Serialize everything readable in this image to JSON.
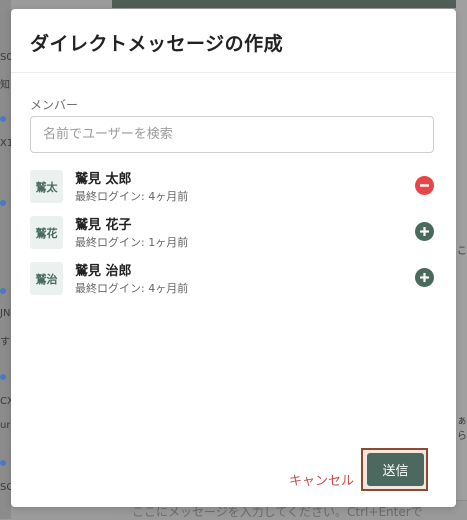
{
  "background": {
    "side_fragments": [
      "S0",
      "知",
      "X1",
      "JN",
      "す",
      "CX",
      "ur",
      "SC"
    ],
    "right_fragments": [
      "こ",
      "ぁ",
      "ら"
    ],
    "bottom_text": "ここにメッセージを入力してください。Ctrl+Enterで"
  },
  "modal": {
    "title": "ダイレクトメッセージの作成",
    "member_label": "メンバー",
    "search": {
      "placeholder": "名前でユーザーを検索",
      "value": ""
    },
    "users": [
      {
        "avatar": "鷲太",
        "name": "鷲見 太郎",
        "last_login": "最終ログイン: 4ヶ月前",
        "action": "remove"
      },
      {
        "avatar": "鷲花",
        "name": "鷲見 花子",
        "last_login": "最終ログイン: 1ヶ月前",
        "action": "add"
      },
      {
        "avatar": "鷲治",
        "name": "鷲見 治郎",
        "last_login": "最終ログイン: 4ヶ月前",
        "action": "add"
      }
    ],
    "cancel_label": "キャンセル",
    "send_label": "送信"
  },
  "colors": {
    "accent": "#4c6960",
    "remove": "#e84646",
    "cancel_text": "#c94f4f"
  }
}
